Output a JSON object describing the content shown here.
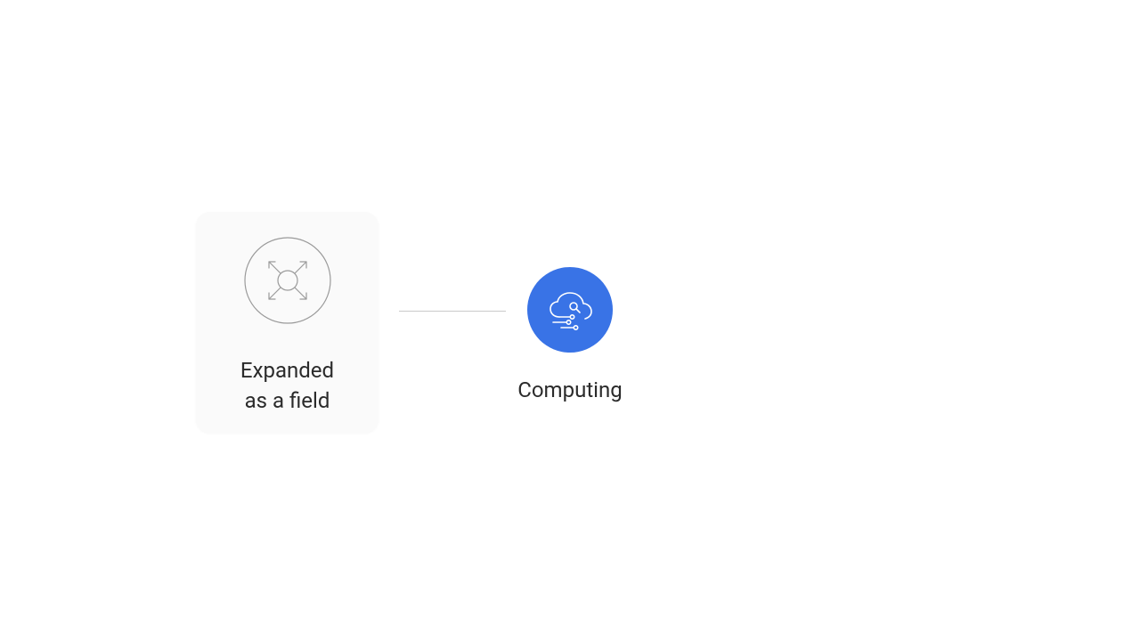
{
  "diagram": {
    "left_card": {
      "label_line1": "Expanded",
      "label_line2": "as a field",
      "icon": "expand-arrows-icon"
    },
    "right_node": {
      "label": "Computing",
      "icon": "cloud-circuit-icon",
      "color": "#3973e6"
    }
  }
}
